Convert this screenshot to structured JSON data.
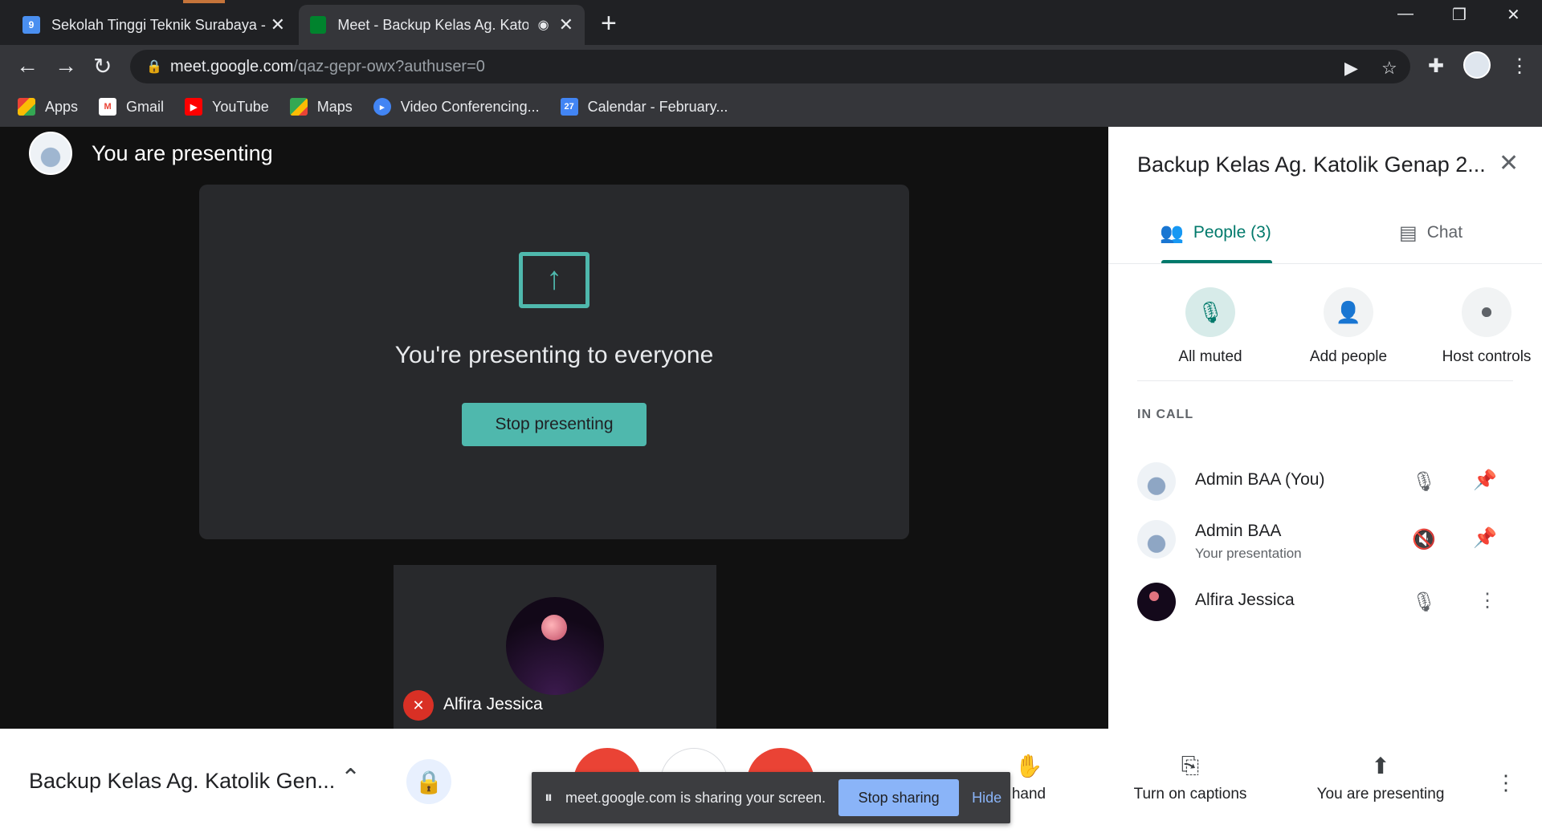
{
  "browser": {
    "tabs": [
      {
        "title": "Sekolah Tinggi Teknik Surabaya -",
        "favicon_text": "9",
        "close": "✕"
      },
      {
        "title": "Meet - Backup Kelas Ag. Katolik",
        "favicon_text": "",
        "close": "✕"
      }
    ],
    "new_tab": "+",
    "window_controls": {
      "minimize": "—",
      "restore": "❐",
      "close": "✕"
    },
    "nav": {
      "back": "←",
      "forward": "→",
      "reload": "↻"
    },
    "address": {
      "lock": "🔒",
      "domain": "meet.google.com",
      "path": "/qaz-gepr-owx?authuser=0"
    },
    "omnibox_icons": {
      "camera": "▶",
      "star": "☆"
    },
    "toolbar_icons": {
      "extensions": "✚",
      "menu": "⋮"
    },
    "bookmarks": [
      {
        "label": "Apps",
        "icon": "apps-grid-icon",
        "color": "#ea4335"
      },
      {
        "label": "Gmail",
        "icon": "gmail-icon",
        "color": "#ea4335"
      },
      {
        "label": "YouTube",
        "icon": "youtube-icon",
        "color": "#ff0000"
      },
      {
        "label": "Maps",
        "icon": "maps-icon",
        "color": "#34a853"
      },
      {
        "label": "Video Conferencing...",
        "icon": "video-icon",
        "color": "#4285f4"
      },
      {
        "label": "Calendar - February...",
        "icon": "calendar-icon",
        "color": "#4285f4",
        "badge": "27"
      }
    ]
  },
  "stage": {
    "header_title": "You are presenting",
    "present_card": {
      "icon": "present-to-all-icon",
      "arrow": "↑",
      "message": "You're presenting to everyone",
      "stop_label": "Stop presenting"
    },
    "tile": {
      "name": "Alfira Jessica",
      "mic_icon": "✕"
    }
  },
  "panel": {
    "title": "Backup Kelas Ag. Katolik Genap 2...",
    "close": "✕",
    "tabs": [
      {
        "label": "People (3)",
        "icon": "👥",
        "active": true
      },
      {
        "label": "Chat",
        "icon": "▤",
        "active": false
      }
    ],
    "actions": [
      {
        "label": "All muted",
        "icon": "🎙"
      },
      {
        "label": "Add people",
        "icon": "👤"
      },
      {
        "label": "Host controls",
        "icon": "⏺"
      }
    ],
    "section_label": "IN CALL",
    "participants": [
      {
        "name": "Admin BAA (You)",
        "sub": "",
        "icon1": "🎙",
        "icon2": "📌"
      },
      {
        "name": "Admin BAA",
        "sub": "Your presentation",
        "icon1": "🔇",
        "icon2": "📌"
      },
      {
        "name": "Alfira Jessica",
        "sub": "",
        "icon1": "🎙",
        "icon2": "⋮"
      }
    ]
  },
  "bottom_bar": {
    "meeting_title": "Backup Kelas Ag. Katolik Gen...",
    "chevron": "⌃",
    "shield": "🔒",
    "raise_hand": {
      "icon": "✋",
      "label": "hand"
    },
    "captions": {
      "icon": "⎘",
      "label": "Turn on captions"
    },
    "presenting": {
      "icon": "⬆",
      "label": "You are presenting"
    },
    "more": "⋮"
  },
  "share_notice": {
    "pause_icon": "⏸",
    "message": "meet.google.com is sharing your screen.",
    "stop_label": "Stop sharing",
    "hide_label": "Hide"
  },
  "colors": {
    "accent_teal": "#4fb8ad",
    "people_tab": "#00796b",
    "danger_red": "#ea4335",
    "share_blue": "#8ab4f8"
  }
}
